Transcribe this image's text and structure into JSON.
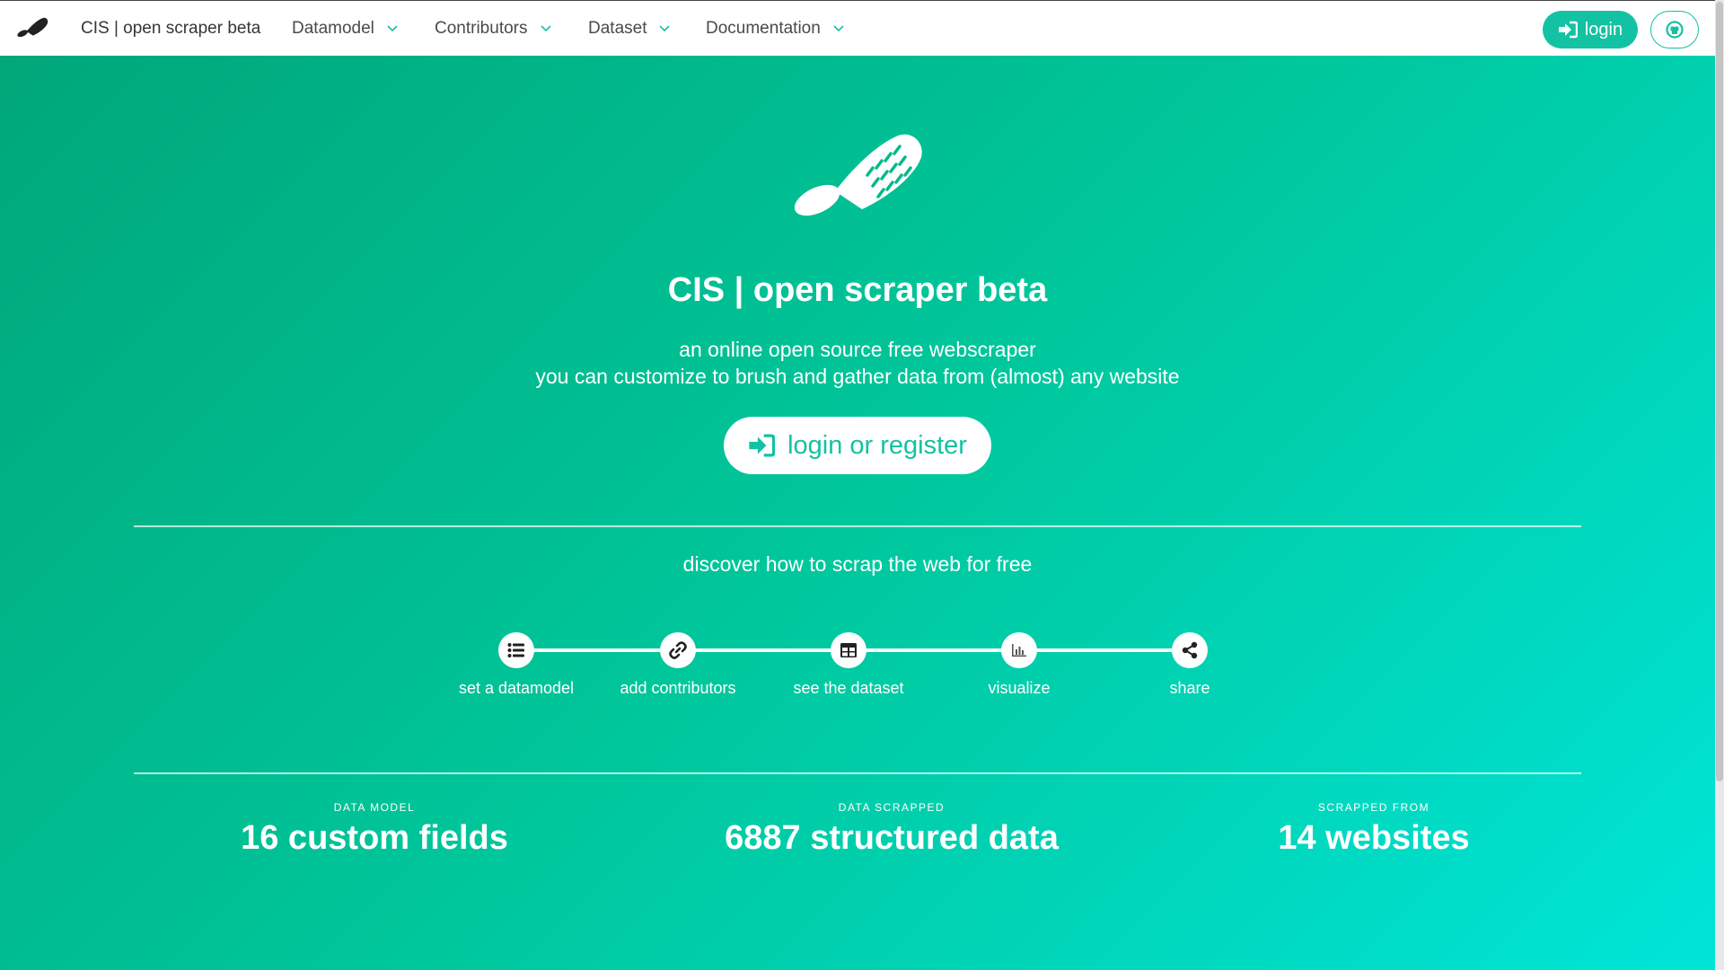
{
  "navbar": {
    "brand": "CIS | open scraper beta",
    "menus": [
      {
        "label": "Datamodel"
      },
      {
        "label": "Contributors"
      },
      {
        "label": "Dataset"
      },
      {
        "label": "Documentation"
      }
    ],
    "login_label": "login",
    "github_icon": "github-icon"
  },
  "hero": {
    "title": "CIS | open scraper beta",
    "subtitle_line1": "an online open source free webscraper",
    "subtitle_line2": "you can customize to brush and gather data from (almost) any website",
    "cta_label": "login or register",
    "discover": "discover how to scrap the web for free"
  },
  "steps": [
    {
      "label": "set a datamodel",
      "icon": "list-icon"
    },
    {
      "label": "add contributors",
      "icon": "link-icon"
    },
    {
      "label": "see the dataset",
      "icon": "table-icon"
    },
    {
      "label": "visualize",
      "icon": "chart-icon"
    },
    {
      "label": "share",
      "icon": "share-icon"
    }
  ],
  "stats": [
    {
      "heading": "Data model",
      "value": "16 custom fields"
    },
    {
      "heading": "Data scrapped",
      "value": "6887 structured data"
    },
    {
      "heading": "Scrapped from",
      "value": "14 websites"
    }
  ],
  "colors": {
    "accent": "#13c2a2",
    "gradient_start": "#00a779",
    "gradient_end": "#00e5d8",
    "nav_text": "#4a4a4a"
  }
}
